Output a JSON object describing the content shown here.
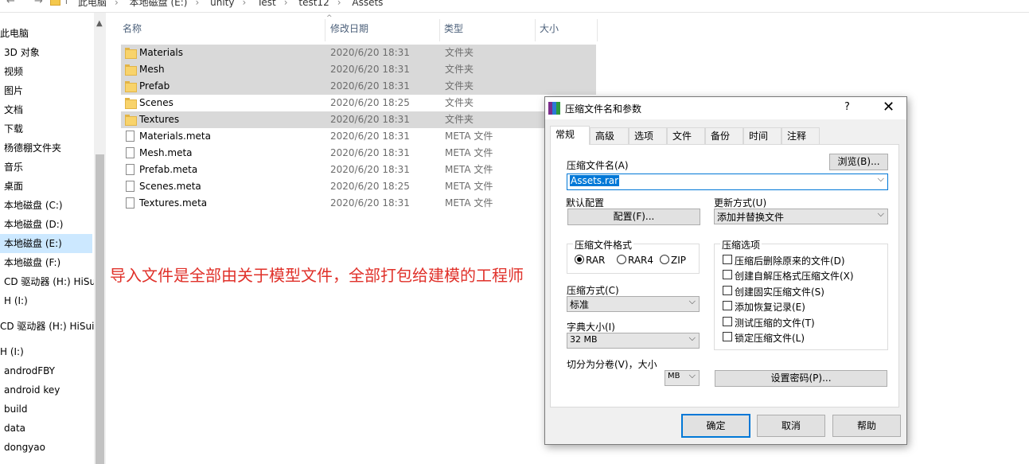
{
  "addressbar": {
    "nav_arrows": "← → ↑",
    "crumbs": [
      "此电脑",
      "本地磁盘 (E:)",
      "unity",
      "Test",
      "test12",
      "Assets"
    ]
  },
  "navpane": {
    "items": [
      "此电脑",
      "3D 对象",
      "视频",
      "图片",
      "文档",
      "下载",
      "杨德棚文件夹",
      "音乐",
      "桌面",
      "本地磁盘 (C:)",
      "本地磁盘 (D:)",
      "本地磁盘 (E:)",
      "本地磁盘 (F:)",
      "CD 驱动器 (H:) HiSu",
      "H (I:)",
      "CD 驱动器 (H:) HiSuit",
      "H (I:)",
      "androdFBY",
      "android key",
      "build",
      "data",
      "dongyao"
    ],
    "selected_index": 11
  },
  "filelist": {
    "headers": {
      "name": "名称",
      "date": "修改日期",
      "type": "类型",
      "size": "大小"
    },
    "rows": [
      {
        "name": "Materials",
        "date": "2020/6/20 18:31",
        "type": "文件夹",
        "icon": "folder-icon",
        "highlighted": true
      },
      {
        "name": "Mesh",
        "date": "2020/6/20 18:31",
        "type": "文件夹",
        "icon": "folder-icon",
        "highlighted": true
      },
      {
        "name": "Prefab",
        "date": "2020/6/20 18:31",
        "type": "文件夹",
        "icon": "folder-icon",
        "highlighted": true
      },
      {
        "name": "Scenes",
        "date": "2020/6/20 18:25",
        "type": "文件夹",
        "icon": "folder-icon",
        "highlighted": false
      },
      {
        "name": "Textures",
        "date": "2020/6/20 18:31",
        "type": "文件夹",
        "icon": "folder-icon",
        "highlighted": true
      },
      {
        "name": "Materials.meta",
        "date": "2020/6/20 18:31",
        "type": "META 文件",
        "icon": "file-icon",
        "highlighted": false
      },
      {
        "name": "Mesh.meta",
        "date": "2020/6/20 18:31",
        "type": "META 文件",
        "icon": "file-icon",
        "highlighted": false
      },
      {
        "name": "Prefab.meta",
        "date": "2020/6/20 18:31",
        "type": "META 文件",
        "icon": "file-icon",
        "highlighted": false
      },
      {
        "name": "Scenes.meta",
        "date": "2020/6/20 18:25",
        "type": "META 文件",
        "icon": "file-icon",
        "highlighted": false
      },
      {
        "name": "Textures.meta",
        "date": "2020/6/20 18:31",
        "type": "META 文件",
        "icon": "file-icon",
        "highlighted": false
      }
    ]
  },
  "annotation": {
    "text": "导入文件是全部由关于模型文件，全部打包给建模的工程师",
    "color": "#e0312a"
  },
  "dialog": {
    "title": "压缩文件名和参数",
    "help": "?",
    "close": "✕",
    "tabs": [
      "常规",
      "高级",
      "选项",
      "文件",
      "备份",
      "时间",
      "注释"
    ],
    "active_tab": 0,
    "archive_name_label": "压缩文件名(A)",
    "browse_button": "浏览(B)...",
    "archive_name_value": "Assets.rar",
    "default_profile_label": "默认配置",
    "profiles_button": "配置(F)...",
    "update_mode_label": "更新方式(U)",
    "update_mode_value": "添加并替换文件",
    "format_group_label": "压缩文件格式",
    "formats": [
      "RAR",
      "RAR4",
      "ZIP"
    ],
    "format_selected": 0,
    "options_group_label": "压缩选项",
    "options": [
      "压缩后删除原来的文件(D)",
      "创建自解压格式压缩文件(X)",
      "创建固实压缩文件(S)",
      "添加恢复记录(E)",
      "测试压缩的文件(T)",
      "锁定压缩文件(L)"
    ],
    "method_label": "压缩方式(C)",
    "method_value": "标准",
    "dict_label": "字典大小(I)",
    "dict_value": "32 MB",
    "split_label": "切分为分卷(V)，大小",
    "split_unit": "MB",
    "password_button": "设置密码(P)...",
    "ok_button": "确定",
    "cancel_button": "取消",
    "help_button": "帮助"
  },
  "colors": {
    "accent": "#0078d7",
    "highlight_row": "#d9d9d9",
    "nav_selected": "#cce8ff",
    "folder": "#f8d36b"
  }
}
